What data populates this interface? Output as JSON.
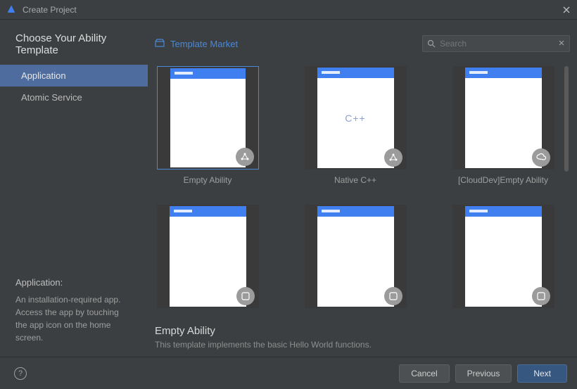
{
  "window": {
    "title": "Create Project"
  },
  "page_title": "Choose Your Ability Template",
  "sidebar": {
    "items": [
      {
        "label": "Application",
        "selected": true
      },
      {
        "label": "Atomic Service",
        "selected": false
      }
    ],
    "description": {
      "title": "Application:",
      "body": "An installation-required app. Access the app by touching the app icon on the home screen."
    }
  },
  "main": {
    "market_link": "Template Market",
    "search": {
      "placeholder": "Search"
    },
    "templates": [
      {
        "label": "Empty Ability",
        "selected": true,
        "badge": "ability-icon",
        "center": ""
      },
      {
        "label": "Native C++",
        "selected": false,
        "badge": "ability-icon",
        "center": "C++"
      },
      {
        "label": "[CloudDev]Empty Ability",
        "selected": false,
        "badge": "cloud-icon",
        "center": ""
      },
      {
        "label": "",
        "selected": false,
        "badge": "generic-icon",
        "center": ""
      },
      {
        "label": "",
        "selected": false,
        "badge": "generic-icon",
        "center": ""
      },
      {
        "label": "",
        "selected": false,
        "badge": "generic-icon",
        "center": ""
      }
    ],
    "detail": {
      "title": "Empty Ability",
      "description": "This template implements the basic Hello World functions."
    }
  },
  "footer": {
    "cancel": "Cancel",
    "previous": "Previous",
    "next": "Next"
  }
}
